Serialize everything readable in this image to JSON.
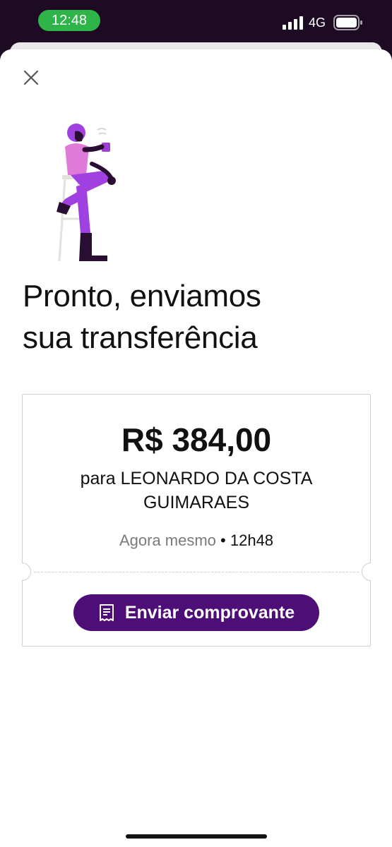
{
  "status_bar": {
    "time": "12:48",
    "network": "4G",
    "icons": [
      "signal-icon",
      "battery-icon"
    ],
    "time_pill_color": "#2fb44a"
  },
  "sheet": {
    "close_icon": "close-icon",
    "illustration": "person-with-coffee-on-stool-illustration",
    "title_line1": "Pronto, enviamos",
    "title_line2": "sua transferência"
  },
  "ticket": {
    "amount": "R$ 384,00",
    "recipient": "para LEONARDO DA COSTA GUIMARAES",
    "datetime_relative": "Agora mesmo",
    "datetime_separator": "•",
    "datetime_time": "12h48",
    "send_button_label": "Enviar comprovante",
    "send_button_icon": "receipt-icon"
  },
  "colors": {
    "brand_purple": "#4d0f77",
    "status_bar_bg": "#1c0b22",
    "illustration_purple": "#a040e0",
    "illustration_pink": "#e07ad8"
  }
}
